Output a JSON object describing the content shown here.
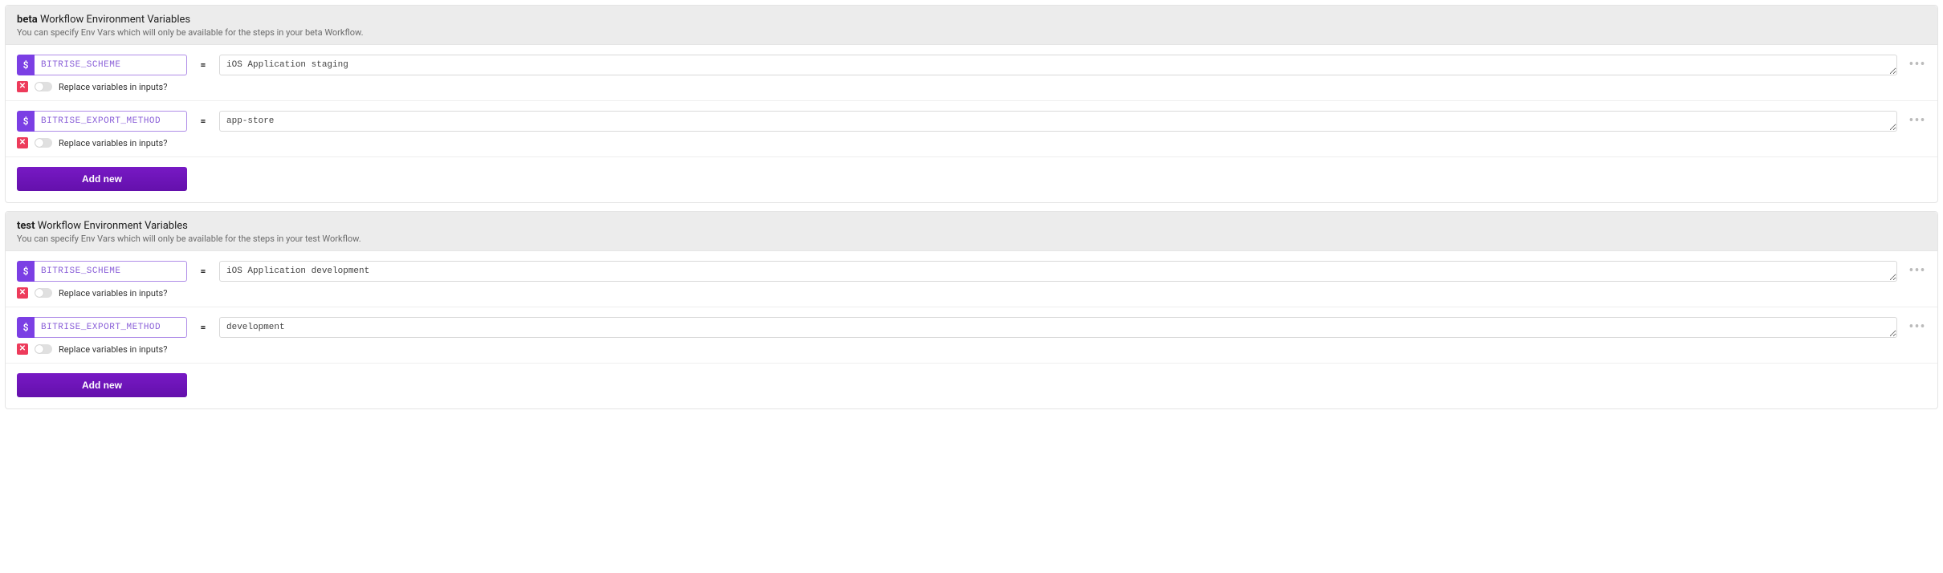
{
  "sections": [
    {
      "name": "beta",
      "title_prefix": "beta",
      "title_rest": "Workflow Environment Variables",
      "subtitle": "You can specify Env Vars which will only be available for the steps in your beta Workflow.",
      "rows": [
        {
          "key": "BITRISE_SCHEME",
          "value": "iOS Application staging",
          "replace_label": "Replace variables in inputs?"
        },
        {
          "key": "BITRISE_EXPORT_METHOD",
          "value": "app-store",
          "replace_label": "Replace variables in inputs?"
        }
      ],
      "add_label": "Add new"
    },
    {
      "name": "test",
      "title_prefix": "test",
      "title_rest": "Workflow Environment Variables",
      "subtitle": "You can specify Env Vars which will only be available for the steps in your test Workflow.",
      "rows": [
        {
          "key": "BITRISE_SCHEME",
          "value": "iOS Application development",
          "replace_label": "Replace variables in inputs?"
        },
        {
          "key": "BITRISE_EXPORT_METHOD",
          "value": "development",
          "replace_label": "Replace variables in inputs?"
        }
      ],
      "add_label": "Add new"
    }
  ],
  "dollar_sign": "$",
  "equals_sign": "=",
  "delete_glyph": "✕",
  "more_glyph": "•••"
}
